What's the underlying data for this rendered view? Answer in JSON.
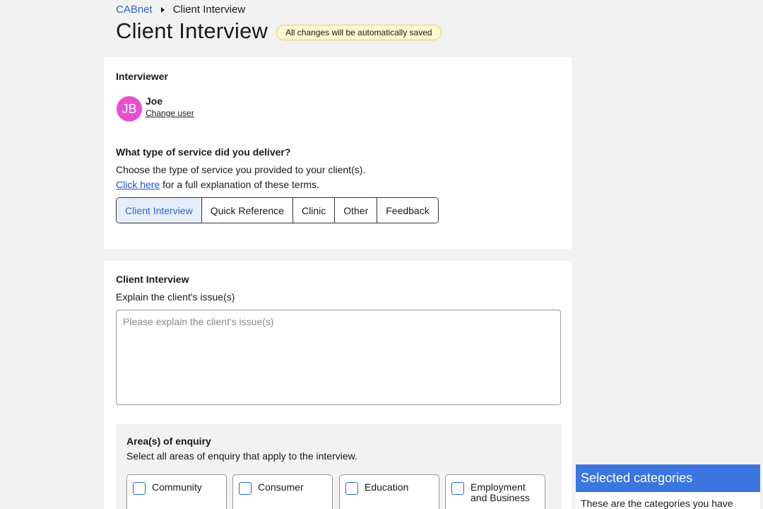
{
  "breadcrumb": {
    "root": "CABnet",
    "current": "Client Interview"
  },
  "header": {
    "title": "Client Interview",
    "autosave_badge": "All changes will be automatically saved"
  },
  "interviewer": {
    "heading": "Interviewer",
    "initials": "JB",
    "name": "Joe",
    "change_user": "Change user"
  },
  "service": {
    "question": "What type of service did you deliver?",
    "description": "Choose the type of service you provided to your client(s).",
    "help_link": "Click here",
    "help_suffix": "for a full explanation of these terms.",
    "options": [
      "Client Interview",
      "Quick Reference",
      "Clinic",
      "Other",
      "Feedback"
    ],
    "selected": "Client Interview"
  },
  "client_interview": {
    "heading": "Client Interview",
    "description": "Explain the client's issue(s)",
    "issue_placeholder": "Please explain the client's issue(s)",
    "issue_value": ""
  },
  "enquiry": {
    "heading": "Area(s) of enquiry",
    "description": "Select all areas of enquiry that apply to the interview.",
    "categories": [
      "Community",
      "Consumer",
      "Education",
      "Employment and Business"
    ]
  },
  "selected_categories": {
    "heading": "Selected categories",
    "body": "These are the categories you have"
  },
  "colors": {
    "accent": "#2d64d6",
    "avatar": "#e54fd0",
    "badge_bg": "#fff7cf",
    "badge_border": "#f3d23f",
    "panel_header": "#3b76e0"
  }
}
